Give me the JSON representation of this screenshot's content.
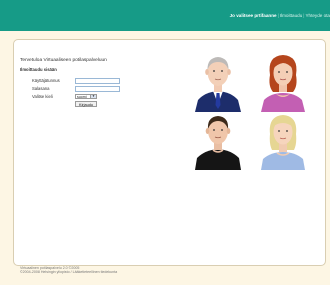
{
  "header": {
    "nav": [
      {
        "label": "Jo valitsee prtifaanne"
      },
      {
        "label": "Ilmoittaudu"
      },
      {
        "label": "Yhteyde ota"
      }
    ],
    "brand_color": "#169b87"
  },
  "main": {
    "title": "Tervetuloa Virtuaaliseen potilaspalveluun",
    "subtitle": "Ilmoittaudu sisään",
    "fields": {
      "username_label": "Käyttäjätunnus",
      "username_value": "",
      "password_label": "Salasana",
      "password_value": "",
      "language_label": "Valitse kieli",
      "language_value": "suomi"
    },
    "submit_label": "Kirjaudu"
  },
  "avatars": [
    {
      "name": "man-in-suit"
    },
    {
      "name": "woman-red-hair"
    },
    {
      "name": "man-black-shirt"
    },
    {
      "name": "woman-blonde"
    }
  ],
  "footer": {
    "line1": "Virtuaalinen potilaspalvelu 2.0 ©2005",
    "line2": "©2004-2008 Helsingin yliopisto / Lääketieteellinen tiedekunta"
  }
}
